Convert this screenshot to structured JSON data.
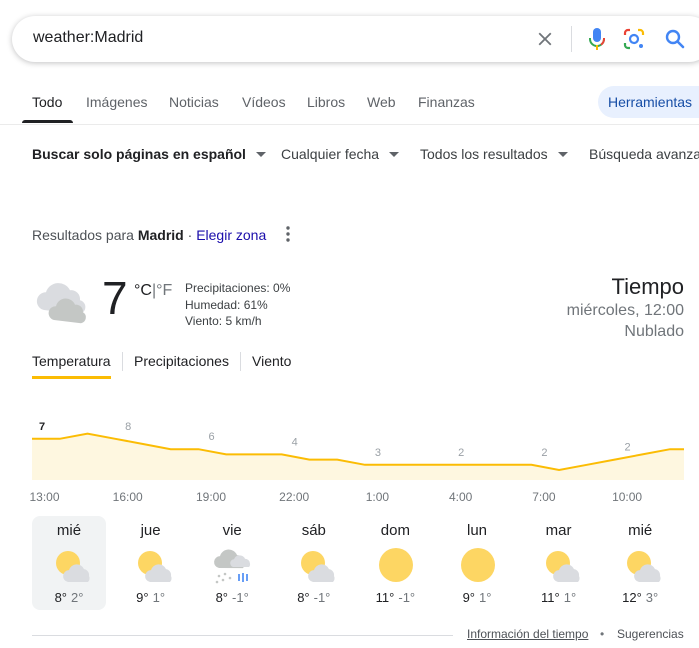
{
  "search": {
    "query": "weather:Madrid"
  },
  "tabs": [
    {
      "label": "Todo"
    },
    {
      "label": "Imágenes"
    },
    {
      "label": "Noticias"
    },
    {
      "label": "Vídeos"
    },
    {
      "label": "Libros"
    },
    {
      "label": "Web"
    },
    {
      "label": "Finanzas"
    }
  ],
  "tools_label": "Herramientas",
  "filters": [
    {
      "label": "Buscar solo páginas en español"
    },
    {
      "label": "Cualquier fecha"
    },
    {
      "label": "Todos los resultados"
    },
    {
      "label": "Búsqueda avanzada"
    }
  ],
  "location": {
    "prefix": "Resultados para",
    "city": "Madrid",
    "sep": "·",
    "change": "Elegir zona"
  },
  "current": {
    "temp": "7",
    "unit_c": "°C",
    "unit_sep": "|",
    "unit_f": "°F",
    "precip": "Precipitaciones: 0%",
    "humidity": "Humedad: 61%",
    "wind": "Viento: 5 km/h",
    "title": "Tiempo",
    "time": "miércoles, 12:00",
    "condition": "Nublado",
    "icon": "cloudy-icon"
  },
  "chart_tabs": [
    {
      "label": "Temperatura"
    },
    {
      "label": "Precipitaciones"
    },
    {
      "label": "Viento"
    }
  ],
  "accent_color": "#fbbc04",
  "chart_data": {
    "type": "area",
    "x": [
      "13:00",
      "14:00",
      "15:00",
      "16:00",
      "17:00",
      "18:00",
      "19:00",
      "20:00",
      "21:00",
      "22:00",
      "23:00",
      "00:00",
      "01:00",
      "02:00",
      "03:00",
      "04:00",
      "05:00",
      "06:00",
      "07:00",
      "08:00",
      "09:00",
      "10:00",
      "11:00",
      "12:00"
    ],
    "values": [
      7,
      7,
      8,
      7,
      6,
      5,
      5,
      4,
      4,
      4,
      3,
      3,
      2,
      2,
      2,
      2,
      2,
      2,
      2,
      1,
      2,
      3,
      4,
      5
    ],
    "labels": [
      {
        "x": "13:00",
        "value": "7"
      },
      {
        "x": "16:00",
        "value": "8"
      },
      {
        "x": "19:00",
        "value": "6"
      },
      {
        "x": "22:00",
        "value": "4"
      },
      {
        "x": "01:00",
        "value": "3"
      },
      {
        "x": "04:00",
        "value": "2"
      },
      {
        "x": "07:00",
        "value": "2"
      },
      {
        "x": "10:00",
        "value": "2"
      }
    ],
    "tick_labels": [
      "13:00",
      "16:00",
      "19:00",
      "22:00",
      "1:00",
      "4:00",
      "7:00",
      "10:00"
    ],
    "line_color": "#fbbc04",
    "fill_color": "#fef7e0"
  },
  "forecast": [
    {
      "day": "mié",
      "icon": "partly-cloudy-icon",
      "hi": "8°",
      "lo": "2°"
    },
    {
      "day": "jue",
      "icon": "partly-cloudy-icon",
      "hi": "9°",
      "lo": "1°"
    },
    {
      "day": "vie",
      "icon": "rain-cloud-icon",
      "hi": "8°",
      "lo": "-1°"
    },
    {
      "day": "sáb",
      "icon": "partly-cloudy-icon",
      "hi": "8°",
      "lo": "-1°"
    },
    {
      "day": "dom",
      "icon": "sunny-icon",
      "hi": "11°",
      "lo": "-1°"
    },
    {
      "day": "lun",
      "icon": "sunny-icon",
      "hi": "9°",
      "lo": "1°"
    },
    {
      "day": "mar",
      "icon": "partly-cloudy-icon",
      "hi": "11°",
      "lo": "1°"
    },
    {
      "day": "mié",
      "icon": "partly-cloudy-icon",
      "hi": "12°",
      "lo": "3°"
    }
  ],
  "footer": {
    "info": "Información del tiempo",
    "dot": "•",
    "suggestions": "Sugerencias"
  }
}
